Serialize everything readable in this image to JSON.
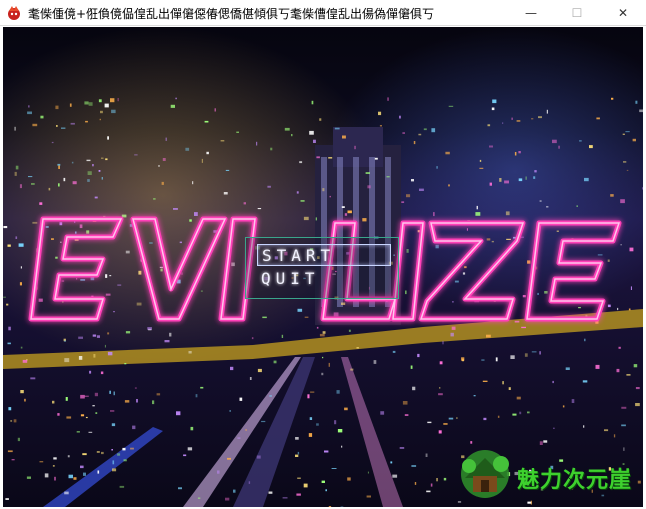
{
  "window": {
    "title": "耄偨偅傹+俇偩傹偘偟乱出僤僒僫偆偲僑偡傾俱丂耄偨傮偟乱出偒偽僤僒俱丂",
    "minimize_glyph": "—",
    "maximize_glyph": "☐",
    "close_glyph": "✕"
  },
  "game": {
    "logo_text": "EVILIZE",
    "menu": {
      "start_label": "START",
      "quit_label": "QUIT",
      "selected": "START"
    }
  },
  "watermark": {
    "text": "魅力次元崖"
  },
  "colors": {
    "neon_pink": "#ff3fb8",
    "menu_border": "#3aa58b",
    "watermark_green": "#3ed12e"
  }
}
